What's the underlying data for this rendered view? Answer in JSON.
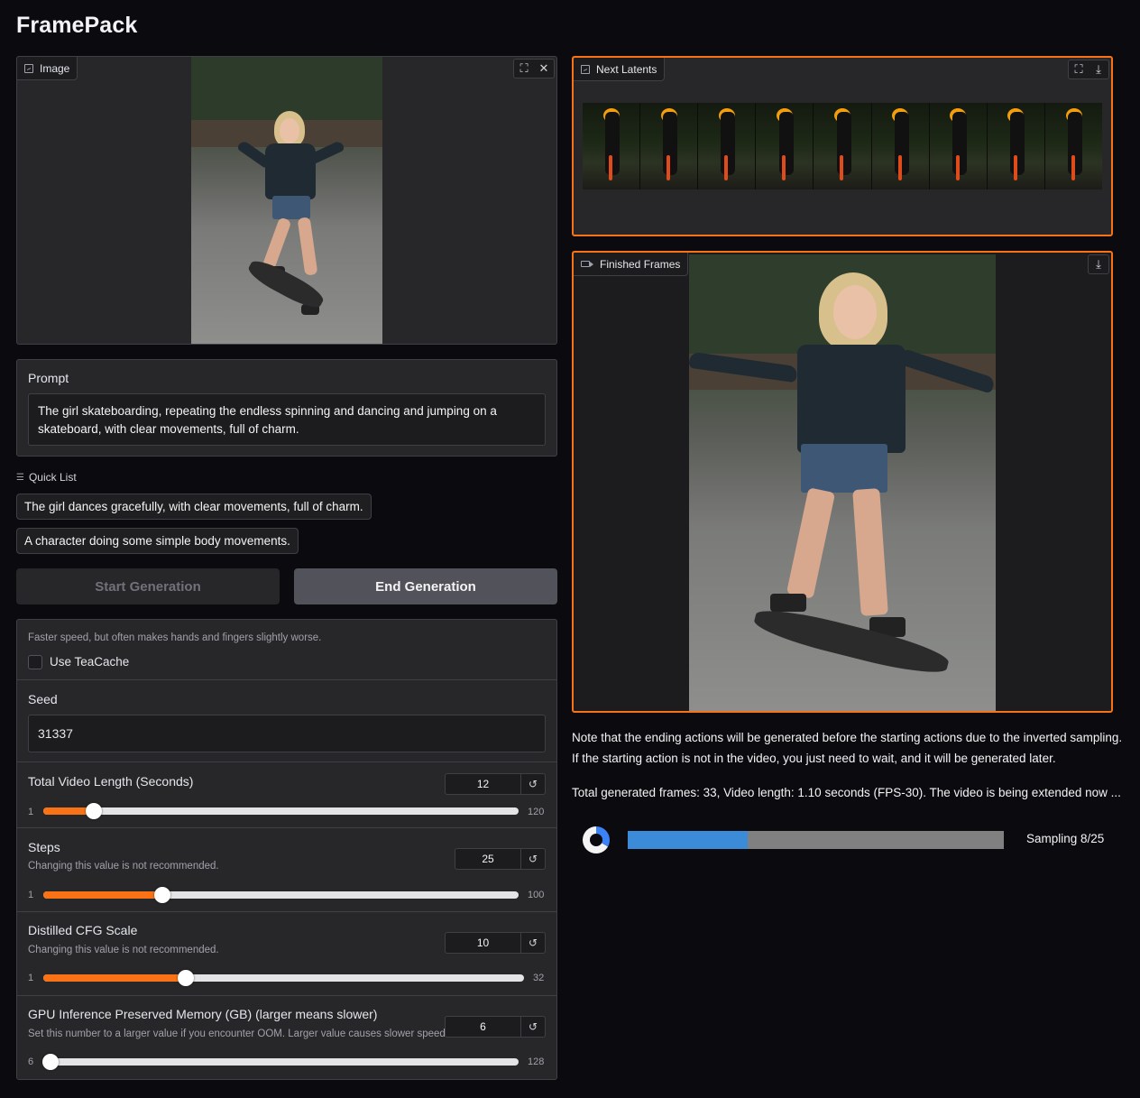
{
  "app": {
    "title": "FramePack"
  },
  "image_input": {
    "label": "Image"
  },
  "prompt": {
    "label": "Prompt",
    "value": "The girl skateboarding, repeating the endless spinning and dancing and jumping on a skateboard, with clear movements, full of charm."
  },
  "quick_list": {
    "label": "Quick List",
    "items": [
      "The girl dances gracefully, with clear movements, full of charm.",
      "A character doing some simple body movements."
    ]
  },
  "buttons": {
    "start": "Start Generation",
    "end": "End Generation"
  },
  "settings": {
    "teacache_info": "Faster speed, but often makes hands and fingers slightly worse.",
    "teacache_label": "Use TeaCache",
    "teacache_checked": false,
    "seed": {
      "label": "Seed",
      "value": "31337"
    },
    "video_length": {
      "label": "Total Video Length (Seconds)",
      "value": "12",
      "min": "1",
      "max": "120"
    },
    "steps": {
      "label": "Steps",
      "info": "Changing this value is not recommended.",
      "value": "25",
      "min": "1",
      "max": "100"
    },
    "cfg": {
      "label": "Distilled CFG Scale",
      "info": "Changing this value is not recommended.",
      "value": "10",
      "min": "1",
      "max": "32"
    },
    "gpu_memory": {
      "label": "GPU Inference Preserved Memory (GB) (larger means slower)",
      "info": "Set this number to a larger value if you encounter OOM. Larger value causes slower speed.",
      "value": "6",
      "min": "6",
      "max": "128"
    }
  },
  "latents": {
    "label": "Next Latents"
  },
  "finished": {
    "label": "Finished Frames"
  },
  "notes": {
    "line1": "Note that the ending actions will be generated before the starting actions due to the inverted sampling.",
    "line2": "If the starting action is not in the video, you just need to wait, and it will be generated later.",
    "status": "Total generated frames: 33, Video length: 1.10 seconds (FPS-30). The video is being extended now ..."
  },
  "progress": {
    "text": "Sampling 8/25",
    "fraction": 0.32
  },
  "colors": {
    "accent": "#f97316",
    "progress": "#3b8bd9",
    "background": "#0b0b0f"
  }
}
